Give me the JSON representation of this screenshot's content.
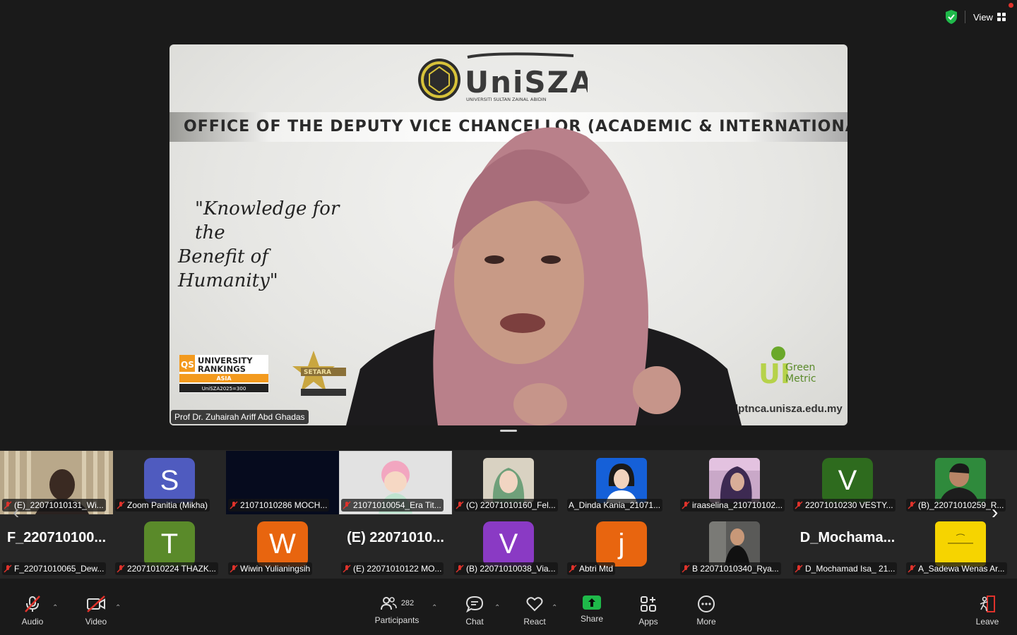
{
  "top": {
    "view_label": "View"
  },
  "slide": {
    "banner": "OFFICE OF THE DEPUTY VICE CHANCELLOR (ACADEMIC & INTERNATIONAL)",
    "logo_text": "UniSZA",
    "logo_sub": "UNIVERSITI SULTAN ZAINAL ABIDIN",
    "motto_line1": "\"Knowledge for the",
    "motto_line2": "Benefit of Humanity\"",
    "qs_line1": "UNIVERSITY",
    "qs_line2": "RANKINGS",
    "qs_line3": "ASIA",
    "qs_line4": "UniSZA2025=300",
    "setara": "SETARA",
    "green1": "Green",
    "green2": "Metric",
    "website": "dptnca.unisza.edu.my",
    "speaker_name": "Prof Dr.  Zuhairah Ariff Abd Ghadas"
  },
  "gallery": {
    "row1": [
      {
        "label": "(E)_22071010131_Wi..."
      },
      {
        "label": "Zoom Panitia (Mikha)",
        "letter": "S",
        "color": "#4f5bbf"
      },
      {
        "label": "21071010286 MOCH..."
      },
      {
        "label": "21071010054_Era Tit..."
      },
      {
        "label": "(C) 22071010160_Fel..."
      },
      {
        "label": "A_Dinda Kania_21071..."
      },
      {
        "label": "iraaselina_210710102..."
      },
      {
        "label": "22071010230 VESTY...",
        "letter": "V",
        "color": "#2e6b1e"
      },
      {
        "label": "(B)_22071010259_R..."
      }
    ],
    "row2": [
      {
        "label": "F_22071010065_Dew...",
        "big": "F_220710100..."
      },
      {
        "label": "22071010224 THAZK...",
        "letter": "T",
        "color": "#5a8a2a"
      },
      {
        "label": "Wiwin Yulianingsih",
        "letter": "W",
        "color": "#e8650f"
      },
      {
        "label": "(E) 22071010122 MO...",
        "big": "(E) 22071010..."
      },
      {
        "label": "(B) 22071010038_Via...",
        "letter": "V",
        "color": "#8a3ac4"
      },
      {
        "label": "Abtri Mtd",
        "letter": "j",
        "color": "#e8650f"
      },
      {
        "label": "B 22071010340_Rya..."
      },
      {
        "label": "D_Mochamad Isa_ 21...",
        "big": "D_Mochama..."
      },
      {
        "label": "A_Sadewa Wenas Ar..."
      }
    ]
  },
  "toolbar": {
    "audio": "Audio",
    "video": "Video",
    "participants": "Participants",
    "participants_count": "282",
    "chat": "Chat",
    "react": "React",
    "share": "Share",
    "apps": "Apps",
    "more": "More",
    "leave": "Leave"
  },
  "colors": {
    "share_green": "#1fb94a",
    "mute_red": "#e0322b",
    "shield_green": "#1fb94a"
  }
}
